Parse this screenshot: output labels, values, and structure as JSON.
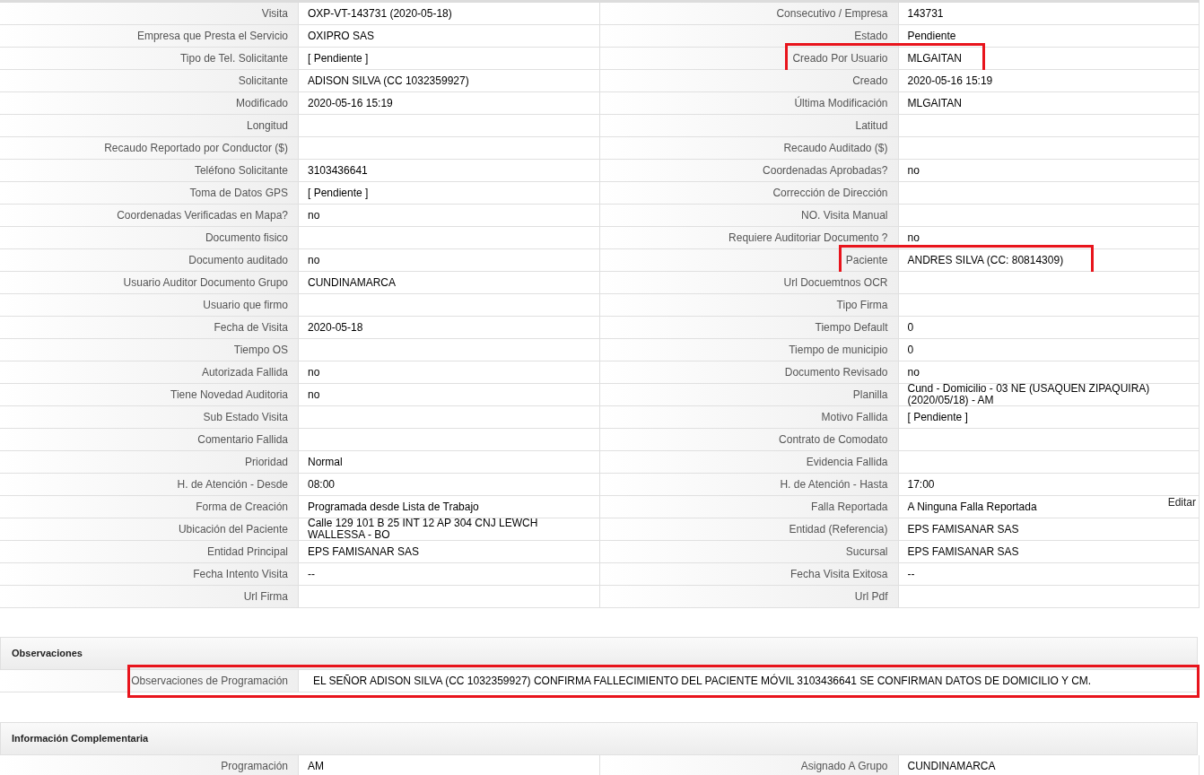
{
  "rows": [
    [
      {
        "label": "Visita",
        "value": "OXP-VT-143731 (2020-05-18)",
        "highlighted": false
      },
      {
        "label": "Consecutivo / Empresa",
        "value": "143731",
        "highlighted": false
      }
    ],
    [
      {
        "label": "Empresa que Presta el Servicio",
        "value": "OXIPRO SAS",
        "highlighted": false
      },
      {
        "label": "Estado",
        "value": "Pendiente",
        "highlighted": false
      }
    ],
    [
      {
        "label": "Tipo de Tel. Solicitante",
        "value": "[ Pendiente ]",
        "highlighted": false
      },
      {
        "label": "Creado Por Usuario",
        "value": "MLGAITAN",
        "highlighted": true
      }
    ],
    [
      {
        "label": "Solicitante",
        "value": "ADISON SILVA (CC 1032359927)",
        "highlighted": false
      },
      {
        "label": "Creado",
        "value": "2020-05-16 15:19",
        "highlighted": false
      }
    ],
    [
      {
        "label": "Modificado",
        "value": "2020-05-16 15:19",
        "highlighted": false
      },
      {
        "label": "Última Modificación",
        "value": "MLGAITAN",
        "highlighted": false
      }
    ],
    [
      {
        "label": "Longitud",
        "highlighted": false
      },
      {
        "label": "Latitud",
        "highlighted": false
      }
    ],
    [
      {
        "label": "Recaudo Reportado por Conductor ($)",
        "highlighted": false
      },
      {
        "label": "Recaudo Auditado ($)",
        "highlighted": false
      }
    ],
    [
      {
        "label": "Teléfono Solicitante",
        "value": "3103436641",
        "highlighted": false
      },
      {
        "label": "Coordenadas Aprobadas?",
        "value": "no",
        "highlighted": false
      }
    ],
    [
      {
        "label": "Toma de Datos GPS",
        "value": "[ Pendiente ]",
        "highlighted": false
      },
      {
        "label": "Corrección de Dirección",
        "highlighted": false
      }
    ],
    [
      {
        "label": "Coordenadas Verificadas en Mapa?",
        "value": "no",
        "highlighted": false
      },
      {
        "label": "NO. Visita Manual",
        "highlighted": false
      }
    ],
    [
      {
        "label": "Documento fisico",
        "highlighted": false
      },
      {
        "label": "Requiere Auditoriar Documento ?",
        "value": "no",
        "highlighted": false
      }
    ],
    [
      {
        "label": "Documento auditado",
        "value": "no",
        "highlighted": false
      },
      {
        "label": "Paciente",
        "value": "ANDRES SILVA (CC: 80814309)",
        "highlighted": true
      }
    ],
    [
      {
        "label": "Usuario Auditor Documento Grupo",
        "value": "CUNDINAMARCA",
        "highlighted": false
      },
      {
        "label": "Url Docuemtnos OCR",
        "highlighted": false
      }
    ],
    [
      {
        "label": "Usuario que firmo",
        "highlighted": false
      },
      {
        "label": "Tipo Firma",
        "highlighted": false
      }
    ],
    [
      {
        "label": "Fecha de Visita",
        "value": "2020-05-18",
        "highlighted": false
      },
      {
        "label": "Tiempo Default",
        "value": "0",
        "highlighted": false
      }
    ],
    [
      {
        "label": "Tiempo OS",
        "highlighted": false
      },
      {
        "label": "Tiempo de municipio",
        "value": "0",
        "highlighted": false
      }
    ],
    [
      {
        "label": "Autorizada Fallida",
        "value": "no",
        "highlighted": false
      },
      {
        "label": "Documento Revisado",
        "value": "no",
        "highlighted": false
      }
    ],
    [
      {
        "label": "Tiene Novedad Auditoria",
        "value": "no",
        "highlighted": false
      },
      {
        "label": "Planilla",
        "value": "Cund - Domicilio - 03 NE (USAQUEN ZIPAQUIRA) (2020/05/18) - AM",
        "highlighted": false
      }
    ],
    [
      {
        "label": "Sub Estado Visita",
        "highlighted": false
      },
      {
        "label": "Motivo Fallida",
        "value": "[ Pendiente ]",
        "highlighted": false
      }
    ],
    [
      {
        "label": "Comentario Fallida",
        "highlighted": false
      },
      {
        "label": "Contrato de Comodato",
        "highlighted": false
      }
    ],
    [
      {
        "label": "Prioridad",
        "value": "Normal",
        "highlighted": false
      },
      {
        "label": "Evidencia Fallida",
        "highlighted": false
      }
    ],
    [
      {
        "label": "H. de Atención - Desde",
        "value": "08:00",
        "highlighted": false
      },
      {
        "label": "H. de Atención - Hasta",
        "value": "17:00",
        "highlighted": false
      }
    ],
    [
      {
        "label": "Forma de Creación",
        "value": "Programada desde Lista de Trabajo",
        "highlighted": false
      },
      {
        "label": "Falla Reportada",
        "value": "A Ninguna Falla Reportada",
        "highlighted": false,
        "action": "Editar"
      }
    ],
    [
      {
        "label": "Ubicación del Paciente",
        "value": "Calle 129 101 B 25 INT 12 AP 304 CNJ LEWCH WALLESSA - BO",
        "highlighted": false
      },
      {
        "label": "Entidad (Referencia)",
        "value": "EPS FAMISANAR SAS",
        "highlighted": false
      }
    ],
    [
      {
        "label": "Entidad Principal",
        "value": "EPS FAMISANAR SAS",
        "highlighted": false
      },
      {
        "label": "Sucursal",
        "value": "EPS FAMISANAR SAS",
        "highlighted": false
      }
    ],
    [
      {
        "label": "Fecha Intento Visita",
        "value": "--",
        "highlighted": false
      },
      {
        "label": "Fecha Visita Exitosa",
        "value": "--",
        "highlighted": false
      }
    ],
    [
      {
        "label": "Url Firma",
        "highlighted": false
      },
      {
        "label": "Url Pdf",
        "highlighted": false
      }
    ]
  ],
  "sections": [
    {
      "title": "Observaciones",
      "rows": [
        [
          {
            "label": "Observaciones de Programación",
            "value": "EL SEÑOR ADISON SILVA (CC 1032359927) CONFIRMA FALLECIMIENTO DEL PACIENTE MÓVIL 3103436641 SE CONFIRMAN DATOS DE DOMICILIO Y CM.",
            "highlighted": true
          }
        ]
      ]
    },
    {
      "title": "Información Complementaria",
      "rows": [
        [
          {
            "label": "Programación",
            "value": "AM",
            "highlighted": false
          },
          {
            "label": "Asignado A Grupo",
            "value": "CUNDINAMARCA",
            "highlighted": false
          }
        ]
      ]
    }
  ]
}
